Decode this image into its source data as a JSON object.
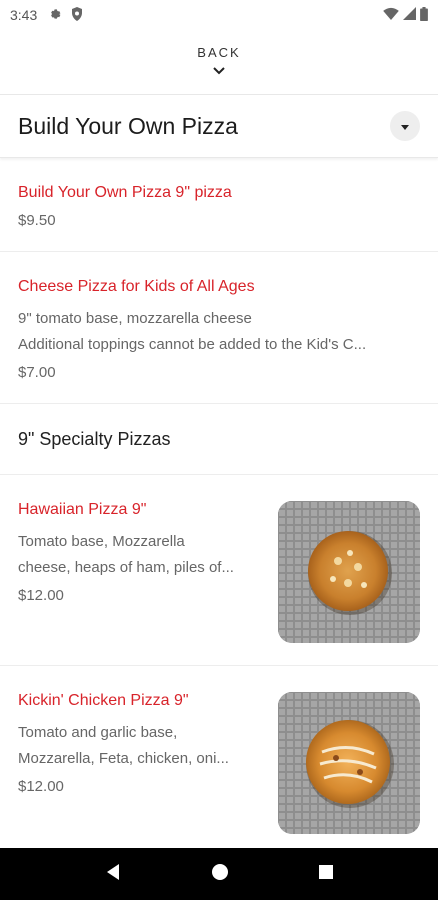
{
  "status": {
    "time": "3:43"
  },
  "nav": {
    "back_label": "BACK"
  },
  "category": {
    "title": "Build Your Own Pizza"
  },
  "items_top": [
    {
      "name": "Build Your Own Pizza 9\" pizza",
      "price": "$9.50"
    },
    {
      "name": "Cheese Pizza for Kids of All Ages",
      "desc1": "9\" tomato base, mozzarella cheese",
      "desc2": "Additional toppings cannot be added to the Kid's C...",
      "price": "$7.00"
    }
  ],
  "section": {
    "title": "9\" Specialty Pizzas"
  },
  "items_specialty": [
    {
      "name": "Hawaiian Pizza 9\"",
      "desc1": "Tomato base, Mozzarella",
      "desc2": "cheese, heaps of ham, piles of...",
      "price": "$12.00"
    },
    {
      "name": "Kickin' Chicken Pizza 9\"",
      "desc1": "Tomato and garlic base,",
      "desc2": "Mozzarella, Feta, chicken, oni...",
      "price": "$12.00"
    }
  ],
  "colors": {
    "accent": "#d8232a",
    "text": "#222222",
    "muted": "#666666"
  }
}
